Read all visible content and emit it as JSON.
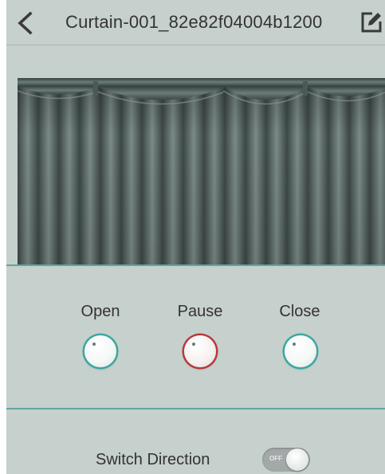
{
  "header": {
    "title": "Curtain-001_82e82f04004b1200",
    "back_icon": "chevron-left-icon",
    "edit_icon": "edit-icon"
  },
  "controls": {
    "open_label": "Open",
    "pause_label": "Pause",
    "close_label": "Close"
  },
  "direction": {
    "label": "Switch Direction",
    "toggle_text": "OFF",
    "enabled": false
  },
  "colors": {
    "background": "#c6d0cc",
    "accent_teal": "#3aa8a0",
    "pause_red": "#b53a3e",
    "curtain": "#55625f"
  }
}
